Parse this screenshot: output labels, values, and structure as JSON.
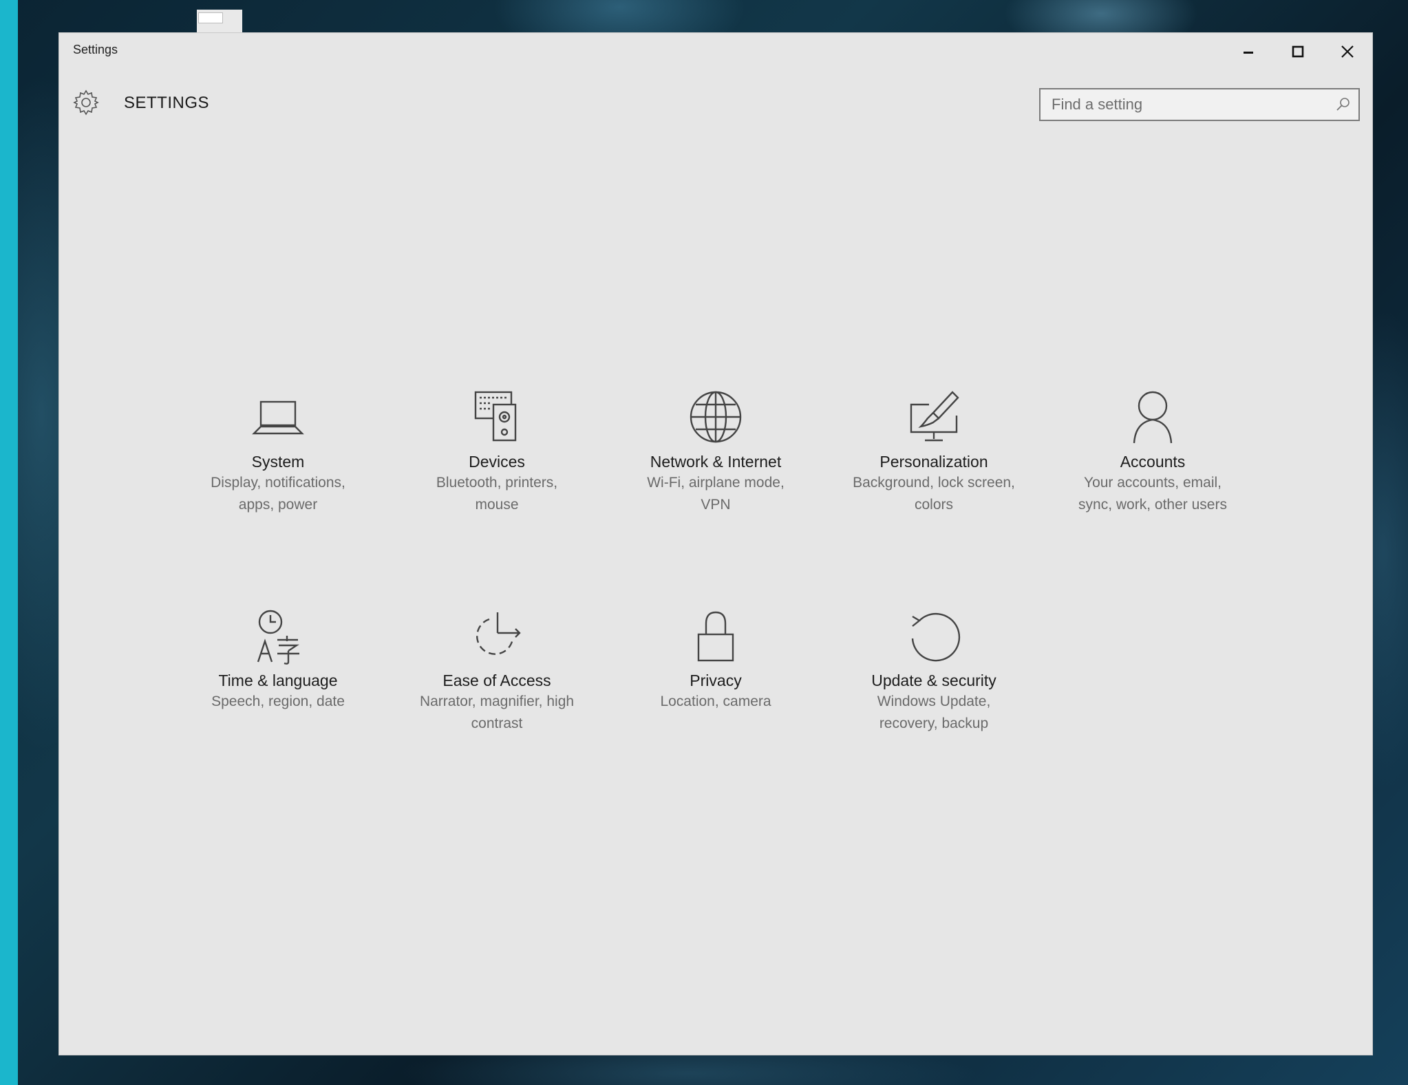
{
  "window": {
    "title": "Settings"
  },
  "header": {
    "title": "SETTINGS",
    "search_placeholder": "Find a setting"
  },
  "tiles": [
    {
      "title": "System",
      "desc": "Display, notifications, apps, power",
      "icon": "laptop-icon"
    },
    {
      "title": "Devices",
      "desc": "Bluetooth, printers, mouse",
      "icon": "keyboard-speaker-icon"
    },
    {
      "title": "Network & Internet",
      "desc": "Wi-Fi, airplane mode, VPN",
      "icon": "globe-icon"
    },
    {
      "title": "Personalization",
      "desc": "Background, lock screen, colors",
      "icon": "paintbrush-monitor-icon"
    },
    {
      "title": "Accounts",
      "desc": "Your accounts, email, sync, work, other users",
      "icon": "person-icon"
    },
    {
      "title": "Time & language",
      "desc": "Speech, region, date",
      "icon": "clock-language-icon"
    },
    {
      "title": "Ease of Access",
      "desc": "Narrator, magnifier, high contrast",
      "icon": "ease-of-access-icon"
    },
    {
      "title": "Privacy",
      "desc": "Location, camera",
      "icon": "lock-icon"
    },
    {
      "title": "Update & security",
      "desc": "Windows Update, recovery, backup",
      "icon": "refresh-icon"
    }
  ]
}
